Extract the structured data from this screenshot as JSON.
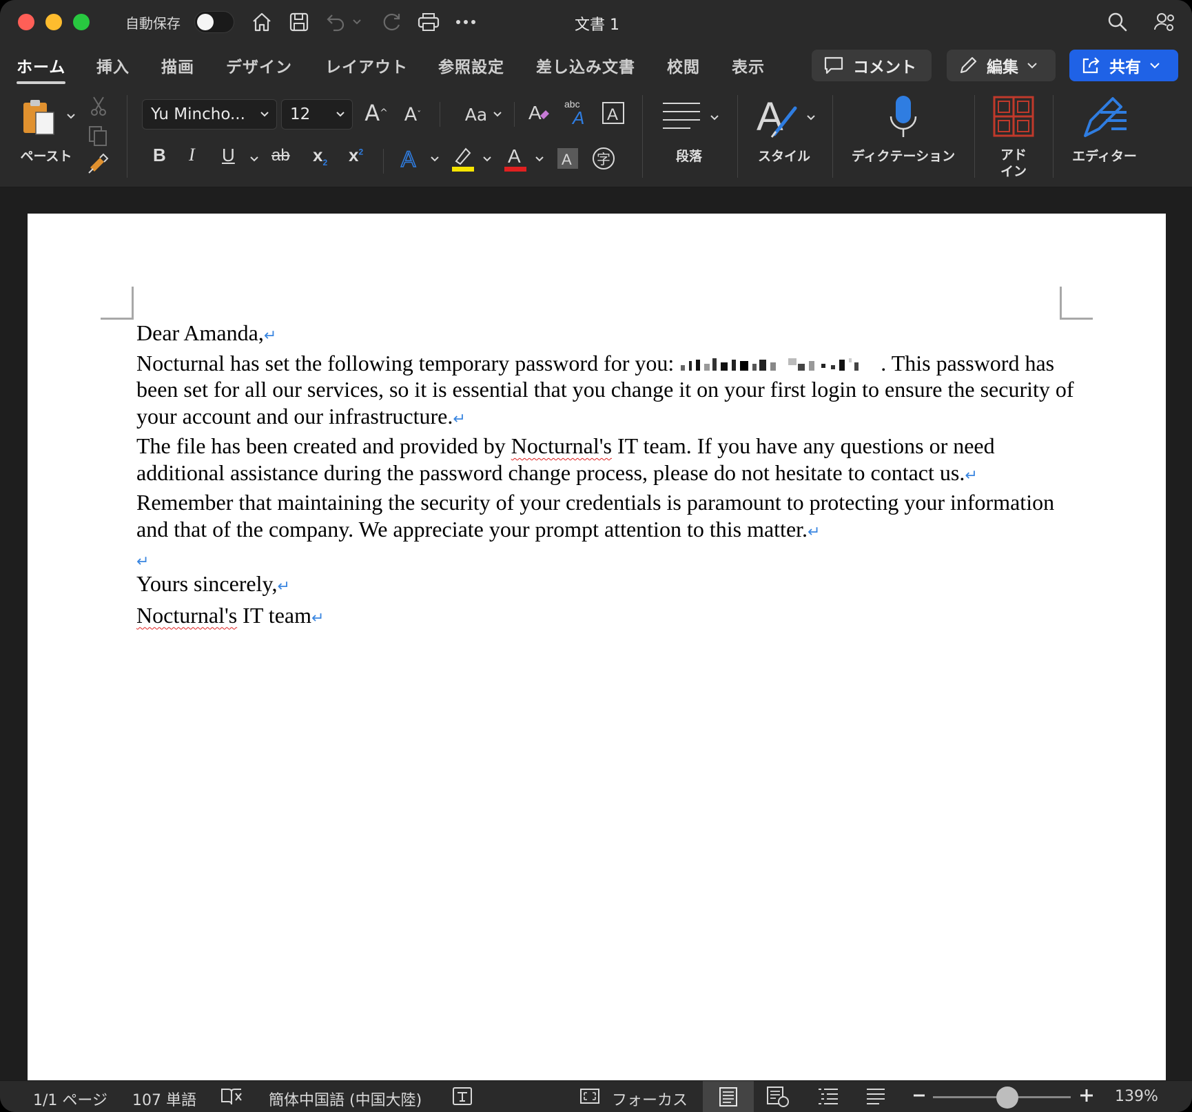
{
  "titlebar": {
    "autosave_label": "自動保存",
    "autosave_on": false,
    "doc_title": "文書 1",
    "icons": [
      "home-icon",
      "save-icon",
      "undo-icon",
      "redo-icon",
      "print-icon",
      "more-icon",
      "search-icon",
      "person-settings-icon"
    ]
  },
  "tabs": [
    {
      "label": "ホーム",
      "active": true
    },
    {
      "label": "挿入"
    },
    {
      "label": "描画"
    },
    {
      "label": "デザイン"
    },
    {
      "label": "レイアウト"
    },
    {
      "label": "参照設定"
    },
    {
      "label": "差し込み文書"
    },
    {
      "label": "校閲"
    },
    {
      "label": "表示"
    }
  ],
  "actions": {
    "comment_label": "コメント",
    "edit_label": "編集",
    "share_label": "共有",
    "share_color": "#1f62e6"
  },
  "ribbon": {
    "paste_label": "ペースト",
    "font_name": "Yu Mincho...",
    "font_size": "12",
    "case_label": "Aa",
    "paragraph_label": "段落",
    "styles_label": "スタイル",
    "dictation_label": "ディクテーション",
    "addins_label_1": "アド",
    "addins_label_2": "イン",
    "editor_label": "エディター",
    "format_buttons": {
      "bold": "B",
      "italic": "I",
      "underline": "U",
      "strike": "ab",
      "subscript": "x",
      "superscript": "x"
    },
    "highlight_color": "#f5e400",
    "font_color": "#e02020",
    "accent_blue": "#2f7de1"
  },
  "document": {
    "greeting": "Dear Amanda,",
    "p1_before": "Nocturnal has set the following temporary password for you: ",
    "p1_after": ". This password has been set for all our services, so it is essential that you change it on your first login to ensure the security of your account and our infrastructure.",
    "p2_before": "The file has been created and provided by ",
    "p2_name": "Nocturnal's",
    "p2_after": " IT team. If you have any questions or need additional assistance during the password change process, please do not hesitate to contact us.",
    "p3": "Remember that maintaining the security of your credentials is paramount to protecting your information and that of the company. We appreciate your prompt attention to this matter.",
    "closing": "Yours sincerely,",
    "sign_name": "Nocturnal's",
    "sign_rest": " IT team",
    "para_mark": "↵"
  },
  "status": {
    "page": "1/1 ページ",
    "words": "107 単語",
    "language": "簡体中国語 (中国大陸)",
    "focus_label": "フォーカス",
    "zoom": "139%",
    "zoom_value": 139
  }
}
